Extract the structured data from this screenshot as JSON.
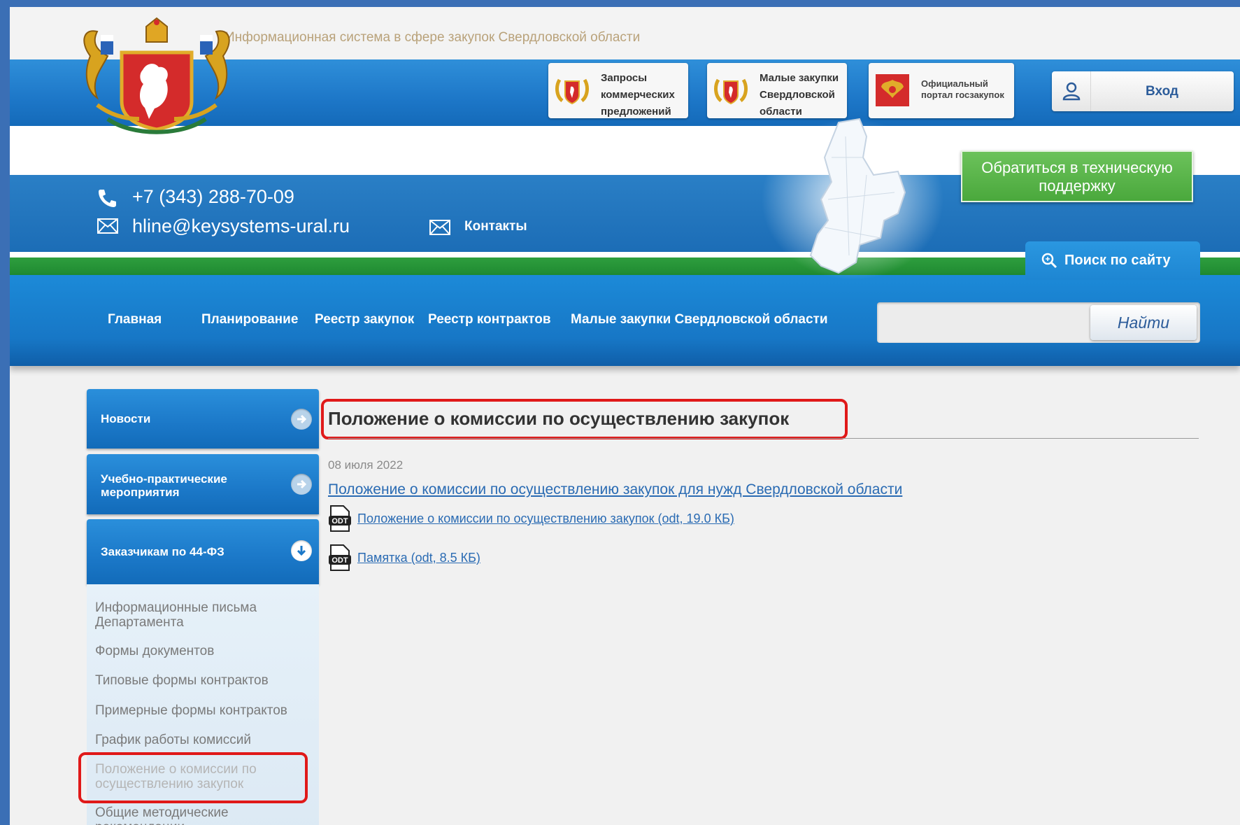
{
  "header": {
    "site_title": "Информационная система в сфере закупок Свердловской области",
    "tiles": [
      {
        "label": "Запросы коммерческих предложений"
      },
      {
        "label": "Малые закупки Свердловской области"
      },
      {
        "label": "Официальный портал госзакупок"
      }
    ],
    "login_label": "Вход",
    "phone": "+7 (343) 288-70-09",
    "email": "hline@keysystems-ural.ru",
    "contacts_label": "Контакты",
    "support_label": "Обратиться в техническую поддержку",
    "site_search_label": "Поиск по сайту"
  },
  "nav": {
    "items": [
      "Главная",
      "Планирование",
      "Реестр закупок",
      "Реестр контрактов",
      "Малые закупки Свердловской области"
    ]
  },
  "search": {
    "value": "",
    "button_label": "Найти"
  },
  "sidebar": {
    "buttons": [
      "Новости",
      "Учебно-практические мероприятия",
      "Заказчикам по 44-ФЗ"
    ],
    "submenu": [
      "Информационные письма Департамента",
      "Формы документов",
      "Типовые формы контрактов",
      "Примерные формы контрактов",
      "График работы комиссий",
      "Положение о комиссии по осуществлению закупок",
      "Общие методические рекомендации"
    ],
    "active_item": "Положение о комиссии по осуществлению закупок"
  },
  "content": {
    "title": "Положение о комиссии по осуществлению закупок",
    "date": "08 июля 2022",
    "main_link": "Положение о комиссии по осуществлению закупок для нужд Свердловской области",
    "files": [
      {
        "label": "Положение о комиссии по осуществлению закупок (odt, 19.0 КБ)",
        "icon": "odt-file-icon"
      },
      {
        "label": "Памятка (odt, 8.5 КБ)",
        "icon": "odt-file-icon"
      }
    ]
  },
  "colors": {
    "brand_blue": "#1c77c6",
    "support_green": "#4aa83c",
    "highlight_red": "#e01919",
    "link": "#2a6bb3"
  }
}
